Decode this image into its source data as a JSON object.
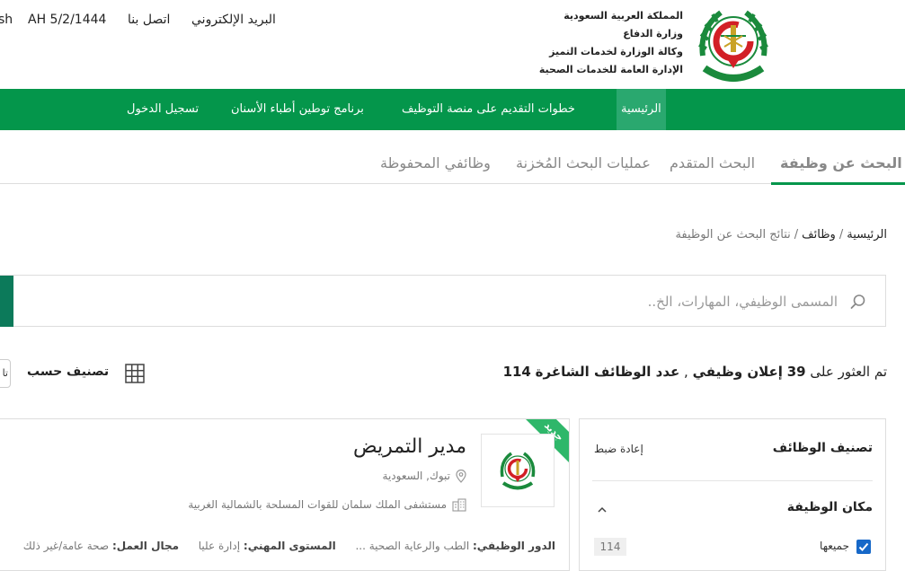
{
  "header": {
    "top_links": {
      "lang_fragment": "sh",
      "hijri_date": "AH 5/2/1444",
      "contact_us": "اتصل بنا",
      "email": "البريد الإلكتروني"
    },
    "org_lines": [
      "المملكة العربية السعودية",
      "وزارة الدفاع",
      "وكالة الوزارة لخدمات التميز",
      "الإدارة العامة للخدمات الصحية"
    ],
    "emblem_icon": "ministry-emblem-icon"
  },
  "nav": {
    "items": [
      "الرئيسية",
      "خطوات التقديم على منصة التوظيف",
      "برنامج توطين أطباء الأسنان",
      "تسجيل الدخول"
    ],
    "bar_color": "#04964b",
    "active_color": "#2aa86f"
  },
  "tabs": [
    "البحث عن وظيفة",
    "البحث المتقدم",
    "عمليات البحث المُخزنة",
    "وظائفي المحفوظة"
  ],
  "breadcrumb": [
    "الرئيسية",
    "وظائف",
    "نتائج البحث عن الوظيفة"
  ],
  "search": {
    "placeholder": "المسمى الوظيفي، المهارات، الخ.."
  },
  "results": {
    "prefix": "تم العثور على",
    "ads_count": "39",
    "ads_label": "إعلان وظيفي",
    "separator": ",",
    "vacancies_label": "عدد الوظائف الشاغرة",
    "vacancies_count": "114"
  },
  "sort": {
    "label": "تصنيف حسب",
    "select_fragment": "تا"
  },
  "job": {
    "badge": "جديد",
    "title": "مدير التمريض",
    "location": "تبوك, السعودية",
    "employer": "مستشفى الملك سلمان للقوات المسلحة بالشمالية الغربية",
    "role_label": "الدور الوظيفي:",
    "role_value": "الطب والرعاية الصحية ...",
    "level_label": "المستوى المهني:",
    "level_value": "إدارة عليا",
    "field_label": "مجال العمل:",
    "field_value": "صحة عامة/غير ذلك"
  },
  "filters": {
    "title": "تصنيف الوظائف",
    "reset": "إعادة ضبط",
    "location_heading": "مكان الوظيفة",
    "all_label": "جميعها",
    "all_count": "114",
    "checkbox_color": "#1668c8"
  }
}
